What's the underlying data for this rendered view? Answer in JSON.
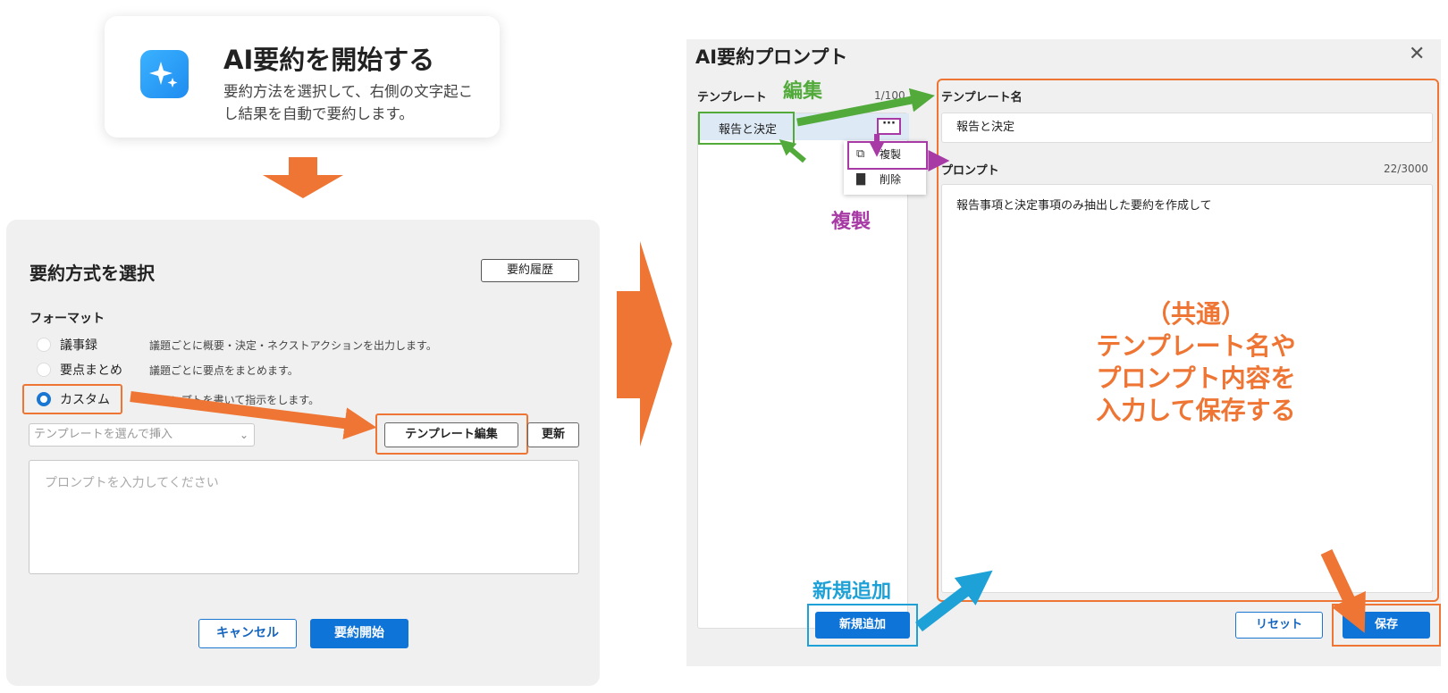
{
  "start_card": {
    "title": "AI要約を開始する",
    "description": "要約方法を選択して、右側の文字起こし結果を自動で要約します。",
    "icon": "sparkle-icon"
  },
  "select_panel": {
    "title": "要約方式を選択",
    "history_button": "要約履歴",
    "format_label": "フォーマット",
    "options": [
      {
        "label": "議事録",
        "description": "議題ごとに概要・決定・ネクストアクションを出力します。",
        "selected": false
      },
      {
        "label": "要点まとめ",
        "description": "議題ごとに要点をまとめます。",
        "selected": false
      },
      {
        "label": "カスタム",
        "description": "プロンプトを書いて指示をします。",
        "selected": true
      }
    ],
    "template_select_placeholder": "テンプレートを選んで挿入",
    "template_edit_button": "テンプレート編集",
    "update_button": "更新",
    "prompt_placeholder": "プロンプトを入力してください",
    "cancel_button": "キャンセル",
    "start_button": "要約開始"
  },
  "prompt_dialog": {
    "title": "AI要約プロンプト",
    "template_label": "テンプレート",
    "template_count": "1/100",
    "templates": [
      {
        "label": "報告と決定"
      }
    ],
    "context_menu": [
      {
        "label": "複製",
        "icon": "copy-icon"
      },
      {
        "label": "削除",
        "icon": "trash-icon"
      }
    ],
    "name_label": "テンプレート名",
    "name_value": "報告と決定",
    "prompt_label": "プロンプト",
    "prompt_count": "22/3000",
    "prompt_value": "報告事項と決定事項のみ抽出した要約を作成して",
    "new_button": "新規追加",
    "reset_button": "リセット",
    "save_button": "保存"
  },
  "annotations": {
    "edit": "編集",
    "duplicate": "複製",
    "new": "新規追加",
    "common_line1": "（共通）",
    "common_line2": "テンプレート名や",
    "common_line3": "プロンプト内容を",
    "common_line4": "入力して保存する"
  },
  "colors": {
    "accent_orange": "#ee7533",
    "accent_green": "#52aa3b",
    "accent_purple": "#a73aa5",
    "accent_cyan": "#1ea1d6",
    "primary_blue": "#0f74d8"
  }
}
